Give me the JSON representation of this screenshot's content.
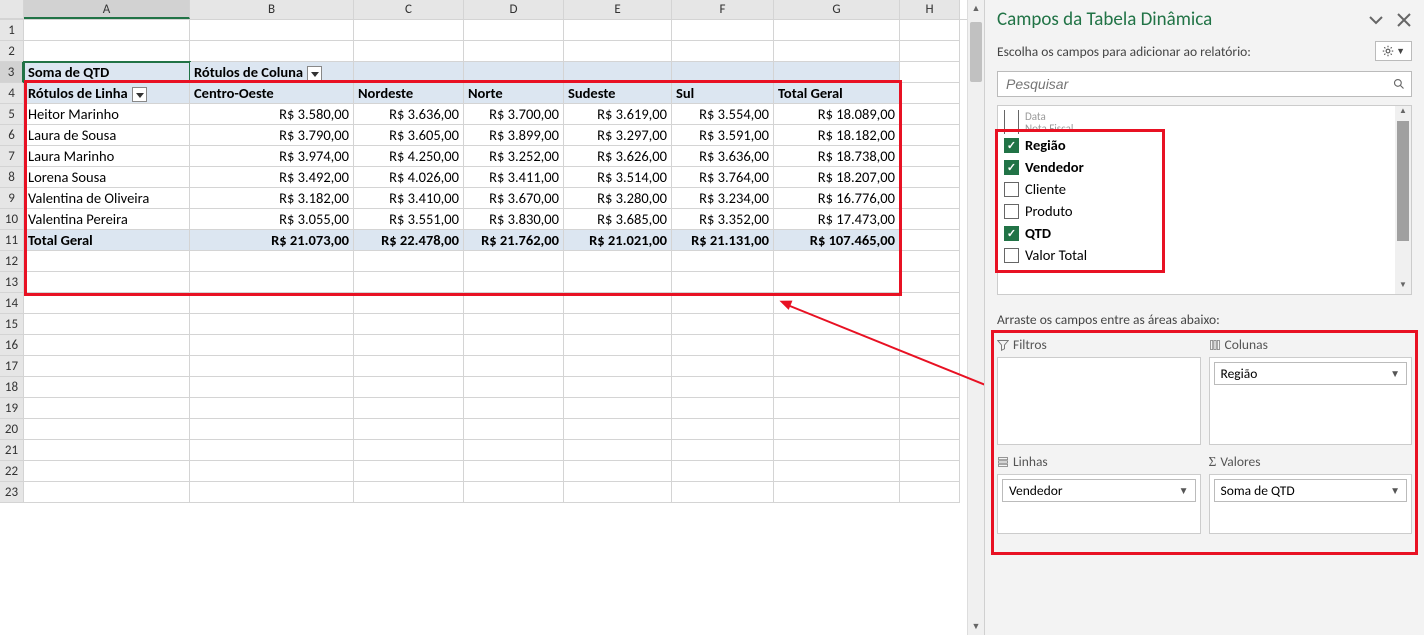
{
  "columns": [
    "A",
    "B",
    "C",
    "D",
    "E",
    "F",
    "G",
    "H"
  ],
  "pivot": {
    "measure_label": "Soma de QTD",
    "col_labels_caption": "Rótulos de Coluna",
    "row_labels_caption": "Rótulos de Linha",
    "col_headers": [
      "Centro-Oeste",
      "Nordeste",
      "Norte",
      "Sudeste",
      "Sul",
      "Total Geral"
    ],
    "rows": [
      {
        "label": "Heitor Marinho",
        "vals": [
          "R$ 3.580,00",
          "R$ 3.636,00",
          "R$ 3.700,00",
          "R$ 3.619,00",
          "R$ 3.554,00",
          "R$ 18.089,00"
        ]
      },
      {
        "label": "Laura de Sousa",
        "vals": [
          "R$ 3.790,00",
          "R$ 3.605,00",
          "R$ 3.899,00",
          "R$ 3.297,00",
          "R$ 3.591,00",
          "R$ 18.182,00"
        ]
      },
      {
        "label": "Laura Marinho",
        "vals": [
          "R$ 3.974,00",
          "R$ 4.250,00",
          "R$ 3.252,00",
          "R$ 3.626,00",
          "R$ 3.636,00",
          "R$ 18.738,00"
        ]
      },
      {
        "label": "Lorena Sousa",
        "vals": [
          "R$ 3.492,00",
          "R$ 4.026,00",
          "R$ 3.411,00",
          "R$ 3.514,00",
          "R$ 3.764,00",
          "R$ 18.207,00"
        ]
      },
      {
        "label": "Valentina de Oliveira",
        "vals": [
          "R$ 3.182,00",
          "R$ 3.410,00",
          "R$ 3.670,00",
          "R$ 3.280,00",
          "R$ 3.234,00",
          "R$ 16.776,00"
        ]
      },
      {
        "label": "Valentina Pereira",
        "vals": [
          "R$ 3.055,00",
          "R$ 3.551,00",
          "R$ 3.830,00",
          "R$ 3.685,00",
          "R$ 3.352,00",
          "R$ 17.473,00"
        ]
      }
    ],
    "grand_row_label": "Total Geral",
    "grand_row": [
      "R$ 21.073,00",
      "R$ 22.478,00",
      "R$ 21.762,00",
      "R$ 21.021,00",
      "R$ 21.131,00",
      "R$ 107.465,00"
    ]
  },
  "panel": {
    "title": "Campos da Tabela Dinâmica",
    "subtitle": "Escolha os campos para adicionar ao relatório:",
    "search_placeholder": "Pesquisar",
    "fields": [
      {
        "name": "Data",
        "checked": false,
        "cut": true
      },
      {
        "name": "Nota Fiscal",
        "checked": false,
        "cut": true
      },
      {
        "name": "Região",
        "checked": true
      },
      {
        "name": "Vendedor",
        "checked": true
      },
      {
        "name": "Cliente",
        "checked": false
      },
      {
        "name": "Produto",
        "checked": false
      },
      {
        "name": "QTD",
        "checked": true
      },
      {
        "name": "Valor Total",
        "checked": false
      }
    ],
    "drag_label": "Arraste os campos entre as áreas abaixo:",
    "areas": {
      "filters": {
        "title": "Filtros",
        "items": []
      },
      "columns": {
        "title": "Colunas",
        "items": [
          "Região"
        ]
      },
      "rows": {
        "title": "Linhas",
        "items": [
          "Vendedor"
        ]
      },
      "values": {
        "title": "Valores",
        "items": [
          "Soma de QTD"
        ]
      }
    }
  }
}
